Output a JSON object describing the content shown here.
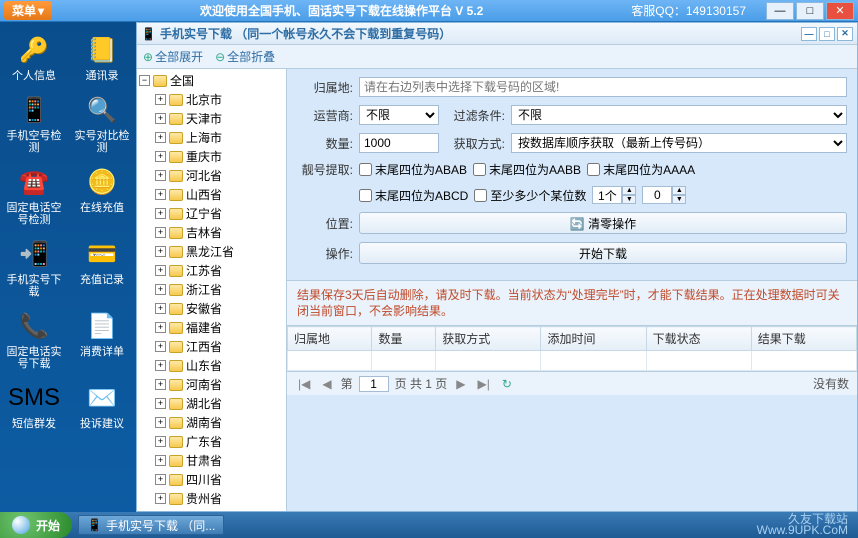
{
  "menubar": {
    "menu_label": "菜单",
    "title": "欢迎使用全国手机、固话实号下载在线操作平台    V 5.2",
    "qq": "客服QQ：149130157"
  },
  "sidebar": {
    "items": [
      {
        "label": "个人信息",
        "icon": "🔑"
      },
      {
        "label": "通讯录",
        "icon": "📒"
      },
      {
        "label": "手机空号检测",
        "icon": "📱"
      },
      {
        "label": "实号对比检测",
        "icon": "🔍"
      },
      {
        "label": "固定电话空号检测",
        "icon": "☎️"
      },
      {
        "label": "在线充值",
        "icon": "🪙"
      },
      {
        "label": "手机实号下载",
        "icon": "📲"
      },
      {
        "label": "充值记录",
        "icon": "💳"
      },
      {
        "label": "固定电话实号下载",
        "icon": "📞"
      },
      {
        "label": "消费详单",
        "icon": "📄"
      },
      {
        "label": "短信群发",
        "icon": "SMS"
      },
      {
        "label": "投诉建议",
        "icon": "✉️"
      }
    ]
  },
  "panel": {
    "title": "手机实号下载 （同一个帐号永久不会下载到重复号码）",
    "expand_all": "全部展开",
    "collapse_all": "全部折叠"
  },
  "tree": {
    "root": "全国",
    "nodes": [
      "北京市",
      "天津市",
      "上海市",
      "重庆市",
      "河北省",
      "山西省",
      "辽宁省",
      "吉林省",
      "黑龙江省",
      "江苏省",
      "浙江省",
      "安徽省",
      "福建省",
      "江西省",
      "山东省",
      "河南省",
      "湖北省",
      "湖南省",
      "广东省",
      "甘肃省",
      "四川省",
      "贵州省"
    ]
  },
  "form": {
    "region_label": "归属地:",
    "region_placeholder": "请在右边列表中选择下载号码的区域!",
    "carrier_label": "运营商:",
    "carrier_value": "不限",
    "filter_label": "过滤条件:",
    "filter_value": "不限",
    "qty_label": "数量:",
    "qty_value": "1000",
    "method_label": "获取方式:",
    "method_value": "按数据库顺序获取（最新上传号码）",
    "nice_label": "靓号提取:",
    "cb1": "末尾四位为ABAB",
    "cb2": "末尾四位为AABB",
    "cb3": "末尾四位为AAAA",
    "cb4": "末尾四位为ABCD",
    "cb5": "至少多少个某位数",
    "spin1": "1个",
    "spin2": "0",
    "pos_label": "位置:",
    "clear_btn": "🔄 清零操作",
    "op_label": "操作:",
    "start_btn": "开始下载"
  },
  "notice": "结果保存3天后自动删除，请及时下载。当前状态为“处理完毕”时，才能下载结果。正在处理数据时可关闭当前窗口，不会影响结果。",
  "table": {
    "headers": [
      "归属地",
      "数量",
      "获取方式",
      "添加时间",
      "下载状态",
      "结果下载"
    ]
  },
  "pager": {
    "page_prefix": "第",
    "page_value": "1",
    "page_mid": "页 共 1 页",
    "nodata": "没有数"
  },
  "taskbar": {
    "start": "开始",
    "task1": "手机实号下载 （同...",
    "wm1": "久友下载站",
    "wm2": "Www.9UPK.CoM"
  }
}
